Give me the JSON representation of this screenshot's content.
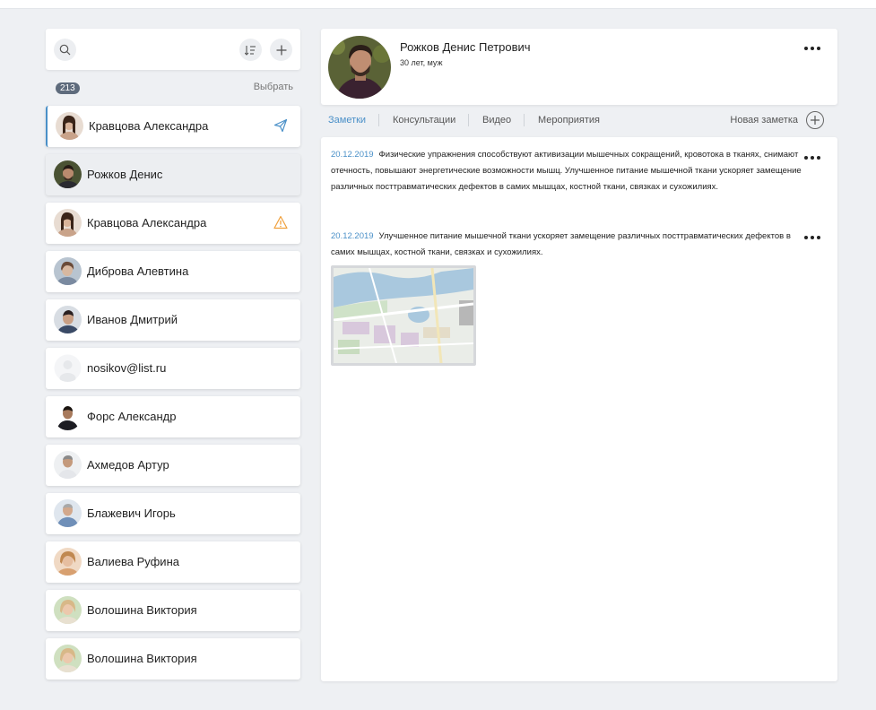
{
  "search": {
    "count_badge": "213",
    "select_label": "Выбрать"
  },
  "contacts": [
    {
      "name": "Кравцова Александра",
      "status_icon": "send-icon"
    },
    {
      "name": "Рожков Денис",
      "status_icon": ""
    },
    {
      "name": "Кравцова Александра",
      "status_icon": "warning-icon"
    },
    {
      "name": "Диброва Алевтина",
      "status_icon": ""
    },
    {
      "name": "Иванов Дмитрий",
      "status_icon": ""
    },
    {
      "name": "nosikov@list.ru",
      "status_icon": ""
    },
    {
      "name": "Форс Александр",
      "status_icon": ""
    },
    {
      "name": "Ахмедов Артур",
      "status_icon": ""
    },
    {
      "name": "Блажевич Игорь",
      "status_icon": ""
    },
    {
      "name": "Валиева Руфина",
      "status_icon": ""
    },
    {
      "name": "Волошина Виктория",
      "status_icon": ""
    },
    {
      "name": "Волошина Виктория",
      "status_icon": ""
    }
  ],
  "profile": {
    "name": "Рожков Денис Петрович",
    "meta": "30 лет, муж"
  },
  "tabs": [
    {
      "label": "Заметки",
      "active": true
    },
    {
      "label": "Консультации",
      "active": false
    },
    {
      "label": "Видео",
      "active": false
    },
    {
      "label": "Мероприятия",
      "active": false
    }
  ],
  "new_note_label": "Новая заметка",
  "notes": [
    {
      "date": "20.12.2019",
      "text": "Физические упражнения способствуют активизации мышечных сокращений, кровотока в тканях, снимают отечность, повышают энергетические возможности мышц. Улучшенное питание мышечной ткани ускоряет замещение различных посттравматических дефектов в самих мышцах, костной ткани, связках и сухожилиях."
    },
    {
      "date": "20.12.2019",
      "text": "Улучшенное питание мышечной ткани ускоряет замещение различных посттравматических дефектов в самих мышцах, костной ткани, связках и сухожилиях."
    }
  ],
  "colors": {
    "accent": "#4a90c8",
    "warning": "#f0a03c",
    "badge": "#5e6b7c"
  }
}
